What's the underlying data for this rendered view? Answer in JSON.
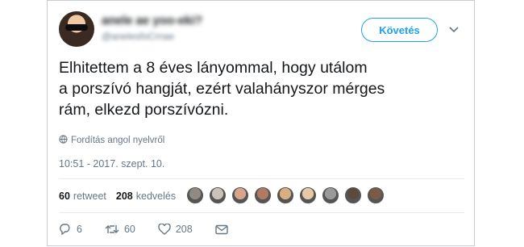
{
  "user": {
    "display_name": "anele ae yoo-eki?",
    "handle": "@anelesfoCrnae"
  },
  "follow_button": "Követés",
  "tweet": {
    "lines": [
      "Elhitettem a 8 éves lányommal, hogy utálom",
      "a porszívó hangját, ezért valahányszor mérges",
      "rám, elkezd porszívózni."
    ]
  },
  "translate_label": "Fordítás angol nyelvről",
  "timestamp": "10:51 - 2017. szept. 10.",
  "stats": {
    "retweet_count": "60",
    "retweet_label": "retweet",
    "like_count": "208",
    "like_label": "kedvelés"
  },
  "liker_avatar_colors": [
    "#8f8a84",
    "#c9c2bb",
    "#d7a58c",
    "#b07b62",
    "#d8b080",
    "#e7c8a6",
    "#9a9a9a",
    "#5b4a40",
    "#7b5a4a"
  ],
  "actions": {
    "reply_count": "6",
    "retweet_count": "60",
    "like_count": "208"
  },
  "colors": {
    "accent": "#1da1f2",
    "muted": "#657786",
    "text": "#14171a"
  }
}
